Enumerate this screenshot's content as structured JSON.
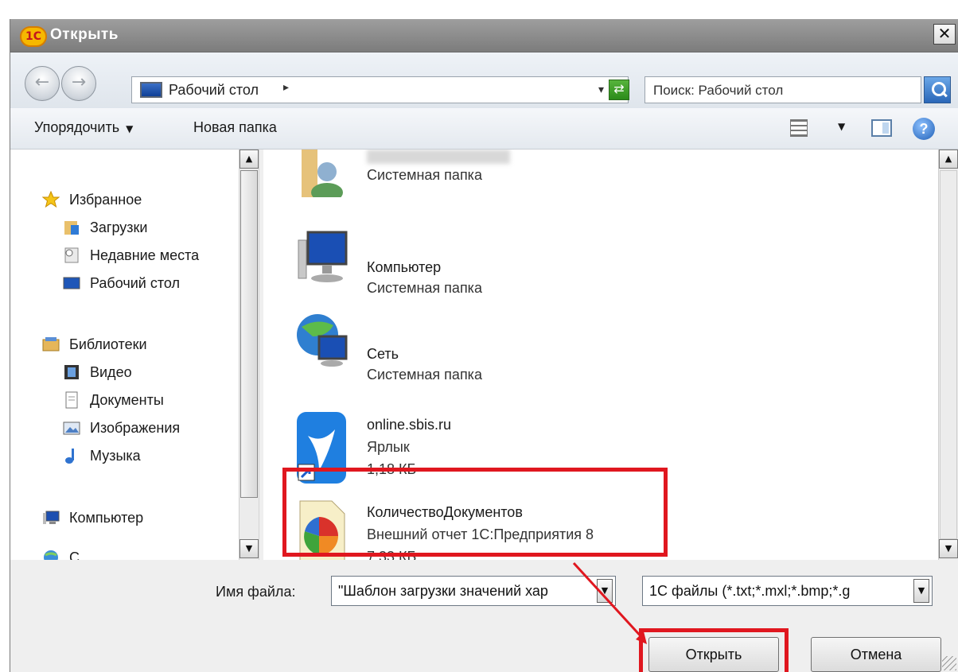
{
  "dialog": {
    "title": "Открыть",
    "app_logo_text": "1С",
    "close_glyph": "✕"
  },
  "navigation": {
    "back_glyph": "←",
    "forward_glyph": "→",
    "address": "Рабочий стол",
    "address_separator": "▸",
    "address_dropdown_glyph": "▾",
    "refresh_glyph": "⇄",
    "search_placeholder": "Поиск: Рабочий стол"
  },
  "toolbar": {
    "organize_label": "Упорядочить",
    "organize_caret": "▼",
    "new_folder_label": "Новая папка",
    "views_caret": "▼",
    "help_glyph": "?"
  },
  "sidebar": {
    "favorites": {
      "label": "Избранное",
      "items": [
        "Загрузки",
        "Недавние места",
        "Рабочий стол"
      ]
    },
    "libraries": {
      "label": "Библиотеки",
      "items": [
        "Видео",
        "Документы",
        "Изображения",
        "Музыка"
      ]
    },
    "computer_label": "Компьютер",
    "network_label": "С"
  },
  "scroll": {
    "up_glyph": "▲",
    "down_glyph": "▼"
  },
  "files": [
    {
      "name": "",
      "line2": "Системная папка",
      "icon": "user-folder-icon"
    },
    {
      "name": "Компьютер",
      "line2": "Системная папка",
      "icon": "computer-icon"
    },
    {
      "name": "Сеть",
      "line2": "Системная папка",
      "icon": "network-icon"
    },
    {
      "name": "online.sbis.ru",
      "line2": "Ярлык",
      "line3": "1,18 КБ",
      "icon": "shortcut-icon"
    },
    {
      "name": "КоличествоДокументов",
      "line2": "Внешний отчет 1С:Предприятия 8",
      "line3": "7,33 КБ",
      "icon": "report-icon"
    }
  ],
  "bottom": {
    "filename_label": "Имя файла:",
    "filename_value": "\"Шаблон загрузки значений хар",
    "filetype_value": "1С файлы (*.txt;*.mxl;*.bmp;*.g",
    "dropdown_glyph": "▼",
    "open_button": "Открыть",
    "cancel_button": "Отмена"
  },
  "colors": {
    "highlight": "#e0171f",
    "titlebar": "#8c8c8c"
  }
}
